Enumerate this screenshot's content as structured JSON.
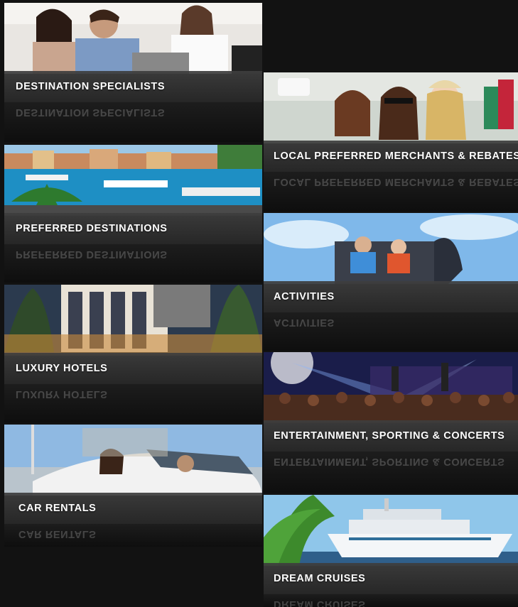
{
  "tiles": [
    {
      "label": "DESTINATION SPECIALISTS",
      "scene": "people-icon"
    },
    {
      "label": "LOCAL PREFERRED MERCHANTS & REBATES",
      "scene": "shopping-icon"
    },
    {
      "label": "PREFERRED DESTINATIONS",
      "scene": "harbor-icon"
    },
    {
      "label": "ACTIVITIES",
      "scene": "ride-icon"
    },
    {
      "label": "LUXURY HOTELS",
      "scene": "hotel-icon"
    },
    {
      "label": "ENTERTAINMENT, SPORTING & CONCERTS",
      "scene": "concert-icon"
    },
    {
      "label": "CAR RENTALS",
      "scene": "car-icon"
    },
    {
      "label": "DREAM CRUISES",
      "scene": "cruise-icon"
    }
  ]
}
